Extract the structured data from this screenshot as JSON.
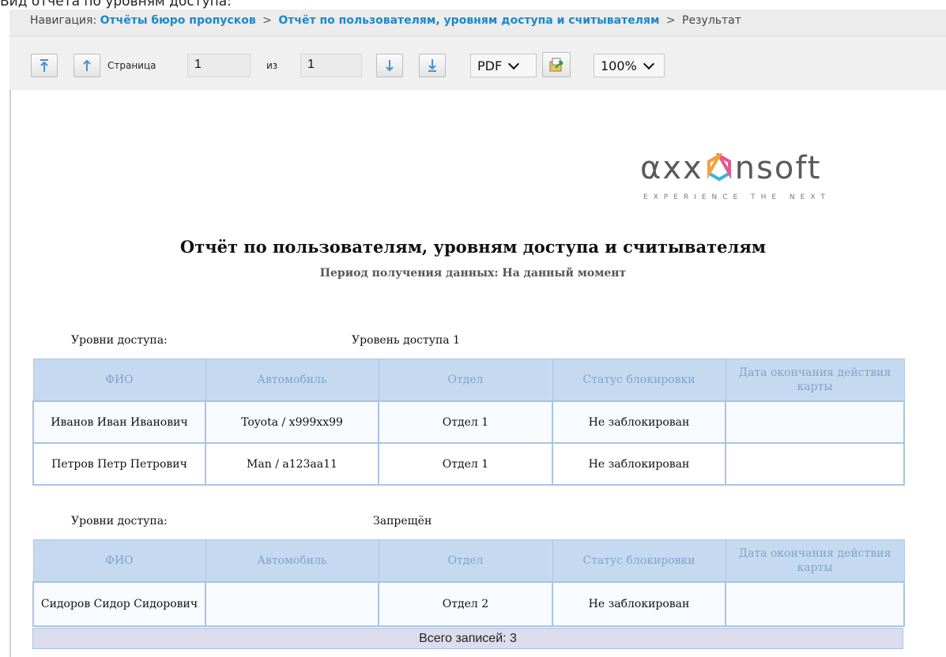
{
  "caption": "Вид отчёта по уровням доступа:",
  "nav": {
    "prefix": "Навигация:",
    "crumbs": [
      "Отчёты бюро пропусков",
      "Отчёт по пользователям, уровням доступа и считывателям"
    ],
    "current": "Результат",
    "separator": ">"
  },
  "toolbar": {
    "page_label": "Страница",
    "page_value": "1",
    "of_label": "из",
    "total_pages": "1",
    "format": "PDF",
    "zoom": "100%",
    "icons": [
      "first-page-icon",
      "prev-page-icon",
      "next-page-icon",
      "last-page-icon",
      "export-icon"
    ]
  },
  "report": {
    "logo_text": "axxonsoft",
    "logo_main_left": "αxx",
    "logo_main_right": "nsoft",
    "logo_tagline": "EXPERIENCE THE NEXT",
    "title": "Отчёт по пользователям, уровням доступа и считывателям",
    "period": "Период получения данных: На данный момент",
    "columns": [
      "ФИО",
      "Автомобиль",
      "Отдел",
      "Статус блокировки",
      "Дата окончания действия карты"
    ],
    "groups": [
      {
        "label": "Уровни доступа:",
        "value": "Уровень доступа 1",
        "rows": [
          [
            "Иванов Иван Иванович",
            "Toyota / х999хх99",
            "Отдел 1",
            "Не заблокирован",
            ""
          ],
          [
            "Петров Петр Петрович",
            "Man / а123аа11",
            "Отдел 1",
            "Не заблокирован",
            ""
          ]
        ]
      },
      {
        "label": "Уровни доступа:",
        "value": "Запрещён",
        "rows": [
          [
            "Сидоров Сидор Сидорович",
            "",
            "Отдел 2",
            "Не заблокирован",
            ""
          ]
        ]
      }
    ],
    "total": "Всего записей: 3"
  },
  "colors": {
    "nav_link": "#1e88c8",
    "header_bg": "#c5daf0",
    "header_text": "#7fa3c9",
    "logo_accent": "#2fb6e0"
  }
}
